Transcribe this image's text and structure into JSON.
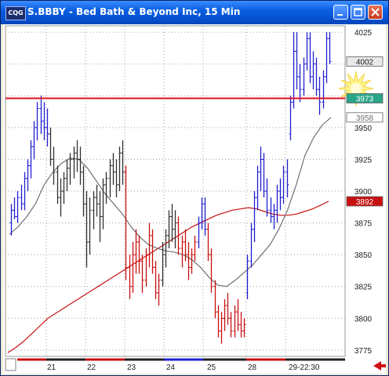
{
  "window": {
    "app_icon_label": "CQG",
    "title": "S.BBBY - Bed Bath & Beyond Inc, 15 Min",
    "buttons": [
      "minimize",
      "maximize",
      "close"
    ]
  },
  "colors": {
    "up": "#1f1fd0",
    "down": "#c81010",
    "neutral": "#303030",
    "long_ma": "#c81010",
    "short_ma": "#707070",
    "level_line": "#e01020",
    "tag_last": "#202020",
    "tag_level": "#2aa58a",
    "tag_ma": "#c81010",
    "tag_other": "#707070"
  },
  "price_axis": {
    "labels": [
      "4025",
      "3950",
      "3925",
      "3900",
      "3875",
      "3850",
      "3825",
      "3800",
      "3775"
    ],
    "tags": [
      {
        "label": "4002",
        "kind": "last"
      },
      {
        "label": "3973",
        "kind": "level"
      },
      {
        "label": "3958",
        "kind": "other"
      },
      {
        "label": "3892",
        "kind": "ma"
      }
    ]
  },
  "date_axis": {
    "labels": [
      "21",
      "22",
      "23",
      "24",
      "25",
      "28",
      "29-22:30"
    ]
  },
  "scroll_arrow": "left-arrow-icon",
  "chart_data": {
    "type": "candlestick",
    "ylim": [
      3770,
      4030
    ],
    "level_line": 3973,
    "bars": [
      [
        3875,
        3890,
        3865,
        3885,
        "u"
      ],
      [
        3885,
        3895,
        3878,
        3880,
        "u"
      ],
      [
        3880,
        3900,
        3875,
        3895,
        "u"
      ],
      [
        3895,
        3905,
        3885,
        3890,
        "u"
      ],
      [
        3890,
        3915,
        3885,
        3910,
        "u"
      ],
      [
        3910,
        3925,
        3900,
        3920,
        "u"
      ],
      [
        3920,
        3940,
        3910,
        3935,
        "u"
      ],
      [
        3935,
        3955,
        3925,
        3950,
        "u"
      ],
      [
        3950,
        3970,
        3940,
        3965,
        "u"
      ],
      [
        3965,
        3975,
        3945,
        3955,
        "u"
      ],
      [
        3955,
        3970,
        3940,
        3950,
        "u"
      ],
      [
        3950,
        3965,
        3935,
        3945,
        "u"
      ],
      [
        3945,
        3950,
        3920,
        3925,
        "n"
      ],
      [
        3925,
        3935,
        3905,
        3915,
        "n"
      ],
      [
        3915,
        3920,
        3890,
        3895,
        "n"
      ],
      [
        3895,
        3910,
        3880,
        3900,
        "n"
      ],
      [
        3900,
        3915,
        3890,
        3910,
        "n"
      ],
      [
        3910,
        3925,
        3900,
        3918,
        "n"
      ],
      [
        3918,
        3930,
        3905,
        3925,
        "n"
      ],
      [
        3925,
        3935,
        3910,
        3930,
        "n"
      ],
      [
        3930,
        3940,
        3915,
        3925,
        "n"
      ],
      [
        3925,
        3935,
        3905,
        3915,
        "n"
      ],
      [
        3915,
        3920,
        3880,
        3890,
        "n"
      ],
      [
        3890,
        3900,
        3840,
        3860,
        "n"
      ],
      [
        3860,
        3895,
        3850,
        3885,
        "n"
      ],
      [
        3885,
        3900,
        3870,
        3895,
        "n"
      ],
      [
        3895,
        3905,
        3880,
        3890,
        "n"
      ],
      [
        3890,
        3900,
        3860,
        3880,
        "n"
      ],
      [
        3880,
        3910,
        3870,
        3905,
        "n"
      ],
      [
        3905,
        3915,
        3890,
        3910,
        "n"
      ],
      [
        3910,
        3925,
        3895,
        3920,
        "n"
      ],
      [
        3920,
        3930,
        3905,
        3915,
        "n"
      ],
      [
        3915,
        3925,
        3895,
        3905,
        "n"
      ],
      [
        3905,
        3935,
        3900,
        3930,
        "n"
      ],
      [
        3930,
        3940,
        3905,
        3915,
        "n"
      ],
      [
        3915,
        3920,
        3830,
        3840,
        "d"
      ],
      [
        3840,
        3850,
        3815,
        3825,
        "d"
      ],
      [
        3825,
        3860,
        3820,
        3850,
        "d"
      ],
      [
        3850,
        3870,
        3835,
        3860,
        "d"
      ],
      [
        3860,
        3865,
        3835,
        3845,
        "d"
      ],
      [
        3845,
        3850,
        3820,
        3830,
        "d"
      ],
      [
        3830,
        3855,
        3825,
        3850,
        "d"
      ],
      [
        3850,
        3875,
        3840,
        3865,
        "d"
      ],
      [
        3865,
        3870,
        3835,
        3840,
        "d"
      ],
      [
        3840,
        3845,
        3815,
        3820,
        "d"
      ],
      [
        3820,
        3835,
        3810,
        3830,
        "d"
      ],
      [
        3830,
        3860,
        3825,
        3850,
        "n"
      ],
      [
        3850,
        3870,
        3840,
        3865,
        "n"
      ],
      [
        3865,
        3885,
        3855,
        3880,
        "n"
      ],
      [
        3880,
        3890,
        3860,
        3870,
        "n"
      ],
      [
        3870,
        3885,
        3855,
        3875,
        "n"
      ],
      [
        3875,
        3880,
        3850,
        3855,
        "d"
      ],
      [
        3855,
        3865,
        3840,
        3860,
        "d"
      ],
      [
        3860,
        3870,
        3845,
        3850,
        "d"
      ],
      [
        3850,
        3860,
        3830,
        3840,
        "d"
      ],
      [
        3840,
        3855,
        3835,
        3850,
        "d"
      ],
      [
        3850,
        3865,
        3845,
        3860,
        "d"
      ],
      [
        3860,
        3880,
        3855,
        3875,
        "u"
      ],
      [
        3875,
        3895,
        3870,
        3890,
        "u"
      ],
      [
        3890,
        3895,
        3865,
        3870,
        "u"
      ],
      [
        3870,
        3875,
        3845,
        3850,
        "d"
      ],
      [
        3850,
        3855,
        3820,
        3825,
        "d"
      ],
      [
        3825,
        3830,
        3800,
        3805,
        "d"
      ],
      [
        3805,
        3810,
        3785,
        3790,
        "d"
      ],
      [
        3790,
        3805,
        3780,
        3800,
        "d"
      ],
      [
        3800,
        3815,
        3790,
        3810,
        "d"
      ],
      [
        3810,
        3820,
        3795,
        3800,
        "d"
      ],
      [
        3800,
        3805,
        3785,
        3790,
        "d"
      ],
      [
        3790,
        3810,
        3785,
        3805,
        "d"
      ],
      [
        3805,
        3815,
        3790,
        3795,
        "d"
      ],
      [
        3795,
        3805,
        3785,
        3790,
        "d"
      ],
      [
        3790,
        3800,
        3785,
        3795,
        "d"
      ],
      [
        3820,
        3850,
        3815,
        3845,
        "u"
      ],
      [
        3845,
        3875,
        3840,
        3870,
        "u"
      ],
      [
        3870,
        3900,
        3860,
        3895,
        "u"
      ],
      [
        3895,
        3920,
        3885,
        3915,
        "u"
      ],
      [
        3915,
        3935,
        3900,
        3925,
        "u"
      ],
      [
        3925,
        3930,
        3895,
        3900,
        "u"
      ],
      [
        3900,
        3910,
        3880,
        3885,
        "u"
      ],
      [
        3885,
        3895,
        3875,
        3880,
        "u"
      ],
      [
        3880,
        3890,
        3870,
        3885,
        "u"
      ],
      [
        3885,
        3905,
        3875,
        3900,
        "u"
      ],
      [
        3900,
        3910,
        3885,
        3895,
        "u"
      ],
      [
        3895,
        3920,
        3890,
        3915,
        "u"
      ],
      [
        3915,
        3925,
        3895,
        3905,
        "u"
      ],
      [
        3945,
        3975,
        3940,
        3970,
        "u"
      ],
      [
        3970,
        4025,
        3965,
        4010,
        "u"
      ],
      [
        4010,
        4025,
        3980,
        3990,
        "u"
      ],
      [
        3990,
        4000,
        3970,
        3980,
        "u"
      ],
      [
        3980,
        4005,
        3975,
        4000,
        "u"
      ],
      [
        4000,
        4025,
        3995,
        4020,
        "u"
      ],
      [
        4020,
        4025,
        3985,
        3990,
        "u"
      ],
      [
        3990,
        4010,
        3980,
        4000,
        "u"
      ],
      [
        4000,
        4005,
        3975,
        3980,
        "u"
      ],
      [
        3980,
        3990,
        3960,
        3970,
        "u"
      ],
      [
        3970,
        3995,
        3965,
        3990,
        "u"
      ],
      [
        3990,
        4025,
        3985,
        4020,
        "u"
      ],
      [
        4020,
        4025,
        4000,
        4002,
        "u"
      ]
    ],
    "long_ma": [
      3773,
      3777,
      3782,
      3788,
      3794,
      3800,
      3804,
      3808,
      3812,
      3816,
      3820,
      3824,
      3828,
      3832,
      3836,
      3840,
      3844,
      3848,
      3852,
      3856,
      3860,
      3864,
      3868,
      3872,
      3875,
      3878,
      3881,
      3883,
      3885,
      3886,
      3887,
      3886,
      3884,
      3882,
      3881,
      3881,
      3882,
      3884,
      3886,
      3889,
      3892
    ],
    "short_ma": [
      3866,
      3872,
      3880,
      3890,
      3905,
      3915,
      3922,
      3926,
      3925,
      3918,
      3908,
      3898,
      3890,
      3882,
      3872,
      3864,
      3858,
      3855,
      3853,
      3852,
      3850,
      3846,
      3840,
      3832,
      3826,
      3825,
      3830,
      3836,
      3842,
      3850,
      3858,
      3870,
      3885,
      3905,
      3928,
      3942,
      3952,
      3958
    ]
  }
}
